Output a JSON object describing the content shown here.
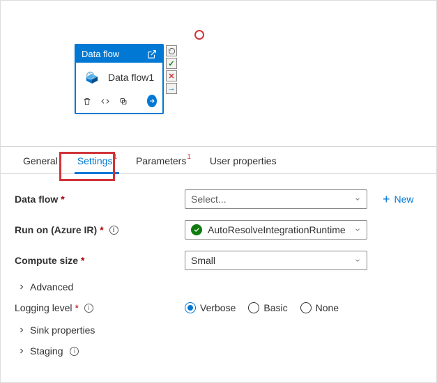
{
  "node": {
    "header": "Data flow",
    "name": "Data flow1"
  },
  "tabs": {
    "general": "General",
    "settings": "Settings",
    "parameters": "Parameters",
    "user_props": "User properties",
    "err_badge": "1"
  },
  "form": {
    "data_flow_label": "Data flow",
    "data_flow_placeholder": "Select...",
    "new_label": "New",
    "run_on_label": "Run on (Azure IR)",
    "run_on_value": "AutoResolveIntegrationRuntime",
    "compute_label": "Compute size",
    "compute_value": "Small",
    "advanced": "Advanced",
    "logging_label": "Logging level",
    "logging_options": {
      "verbose": "Verbose",
      "basic": "Basic",
      "none": "None"
    },
    "sink_props": "Sink properties",
    "staging": "Staging"
  }
}
